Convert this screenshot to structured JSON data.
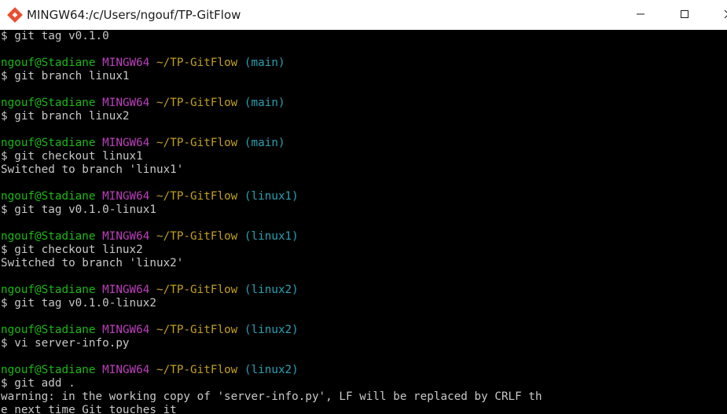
{
  "window": {
    "title": "MINGW64:/c/Users/ngouf/TP-GitFlow",
    "app_icon": "git-bash-icon",
    "controls": {
      "minimize": "minimize-icon",
      "maximize": "maximize-icon",
      "close": "close-icon"
    }
  },
  "colors": {
    "user": "#1bb814",
    "host": "#bd3fbd",
    "path": "#c0a020",
    "branch": "#2aa1b3",
    "text": "#c8c8c8",
    "background": "#000000"
  },
  "terminal": {
    "lines": [
      {
        "kind": "text",
        "text": "$ git tag v0.1.0"
      },
      {
        "kind": "blank",
        "text": ""
      },
      {
        "kind": "prompt",
        "user": "ngouf@Stadiane",
        "host": "MINGW64",
        "path": "~/TP-GitFlow",
        "branch": "(main)"
      },
      {
        "kind": "text",
        "text": "$ git branch linux1"
      },
      {
        "kind": "blank",
        "text": ""
      },
      {
        "kind": "prompt",
        "user": "ngouf@Stadiane",
        "host": "MINGW64",
        "path": "~/TP-GitFlow",
        "branch": "(main)"
      },
      {
        "kind": "text",
        "text": "$ git branch linux2"
      },
      {
        "kind": "blank",
        "text": ""
      },
      {
        "kind": "prompt",
        "user": "ngouf@Stadiane",
        "host": "MINGW64",
        "path": "~/TP-GitFlow",
        "branch": "(main)"
      },
      {
        "kind": "text",
        "text": "$ git checkout linux1"
      },
      {
        "kind": "text",
        "text": "Switched to branch 'linux1'"
      },
      {
        "kind": "blank",
        "text": ""
      },
      {
        "kind": "prompt",
        "user": "ngouf@Stadiane",
        "host": "MINGW64",
        "path": "~/TP-GitFlow",
        "branch": "(linux1)"
      },
      {
        "kind": "text",
        "text": "$ git tag v0.1.0-linux1"
      },
      {
        "kind": "blank",
        "text": ""
      },
      {
        "kind": "prompt",
        "user": "ngouf@Stadiane",
        "host": "MINGW64",
        "path": "~/TP-GitFlow",
        "branch": "(linux1)"
      },
      {
        "kind": "text",
        "text": "$ git checkout linux2"
      },
      {
        "kind": "text",
        "text": "Switched to branch 'linux2'"
      },
      {
        "kind": "blank",
        "text": ""
      },
      {
        "kind": "prompt",
        "user": "ngouf@Stadiane",
        "host": "MINGW64",
        "path": "~/TP-GitFlow",
        "branch": "(linux2)"
      },
      {
        "kind": "text",
        "text": "$ git tag v0.1.0-linux2"
      },
      {
        "kind": "blank",
        "text": ""
      },
      {
        "kind": "prompt",
        "user": "ngouf@Stadiane",
        "host": "MINGW64",
        "path": "~/TP-GitFlow",
        "branch": "(linux2)"
      },
      {
        "kind": "text",
        "text": "$ vi server-info.py"
      },
      {
        "kind": "blank",
        "text": ""
      },
      {
        "kind": "prompt",
        "user": "ngouf@Stadiane",
        "host": "MINGW64",
        "path": "~/TP-GitFlow",
        "branch": "(linux2)"
      },
      {
        "kind": "text",
        "text": "$ git add ."
      },
      {
        "kind": "text",
        "text": "warning: in the working copy of 'server-info.py', LF will be replaced by CRLF th"
      },
      {
        "kind": "text",
        "text": "e next time Git touches it"
      }
    ]
  }
}
